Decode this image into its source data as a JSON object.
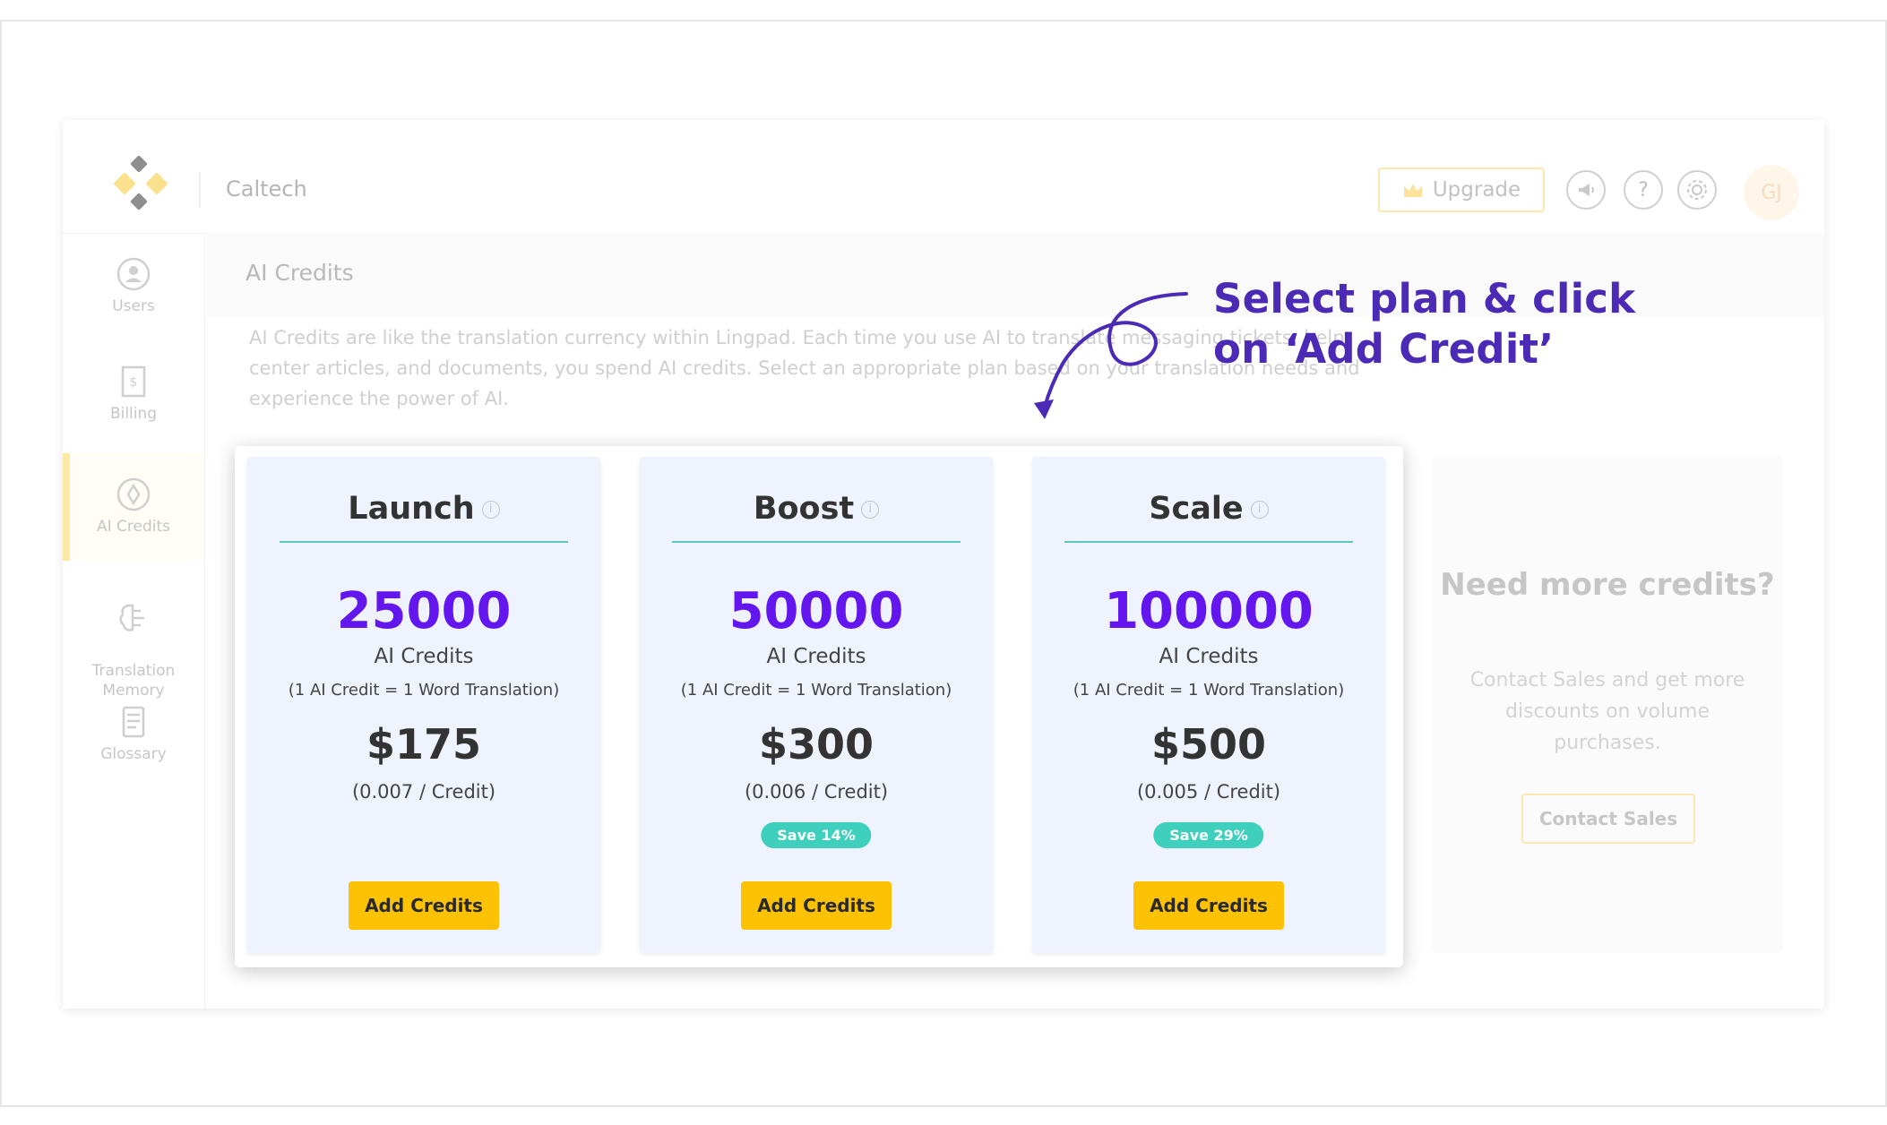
{
  "header": {
    "org_name": "Caltech",
    "upgrade_label": "Upgrade",
    "avatar_initials": "GJ",
    "icons": [
      "announcement-icon",
      "help-icon",
      "settings-icon"
    ]
  },
  "sidebar": {
    "items": [
      {
        "label": "Users",
        "icon": "user-icon"
      },
      {
        "label": "Billing",
        "icon": "billing-icon"
      },
      {
        "label": "AI Credits",
        "icon": "ai-credits-icon",
        "active": true
      },
      {
        "label": "Translation\nMemory",
        "icon": "brain-icon"
      },
      {
        "label": "Glossary",
        "icon": "glossary-icon"
      }
    ]
  },
  "page": {
    "title": "AI Credits",
    "description": "AI Credits are like the translation currency within Lingpad. Each time you use AI to translate messaging tickets, help center articles, and documents, you spend AI credits. Select an appropriate plan based on your translation needs and experience the power of AI."
  },
  "plans": [
    {
      "name": "Launch",
      "credits": "25000",
      "credits_label": "AI Credits",
      "credit_note": "(1 AI Credit = 1 Word Translation)",
      "price": "$175",
      "per_credit": "(0.007 / Credit)",
      "save": "",
      "button": "Add Credits"
    },
    {
      "name": "Boost",
      "credits": "50000",
      "credits_label": "AI Credits",
      "credit_note": "(1 AI Credit = 1 Word Translation)",
      "price": "$300",
      "per_credit": "(0.006 / Credit)",
      "save": "Save 14%",
      "button": "Add Credits"
    },
    {
      "name": "Scale",
      "credits": "100000",
      "credits_label": "AI Credits",
      "credit_note": "(1 AI Credit = 1 Word Translation)",
      "price": "$500",
      "per_credit": "(0.005 / Credit)",
      "save": "Save 29%",
      "button": "Add Credits"
    }
  ],
  "more": {
    "title": "Need more credits?",
    "description": "Contact Sales and get more discounts on volume purchases.",
    "button": "Contact Sales"
  },
  "annotation": {
    "line1": "Select plan & click",
    "line2": "on ‘Add Credit’"
  },
  "colors": {
    "accent": "#6317ee",
    "button": "#fcc203",
    "save_badge": "#3ecfbd",
    "annotation": "#4b2ab6"
  }
}
